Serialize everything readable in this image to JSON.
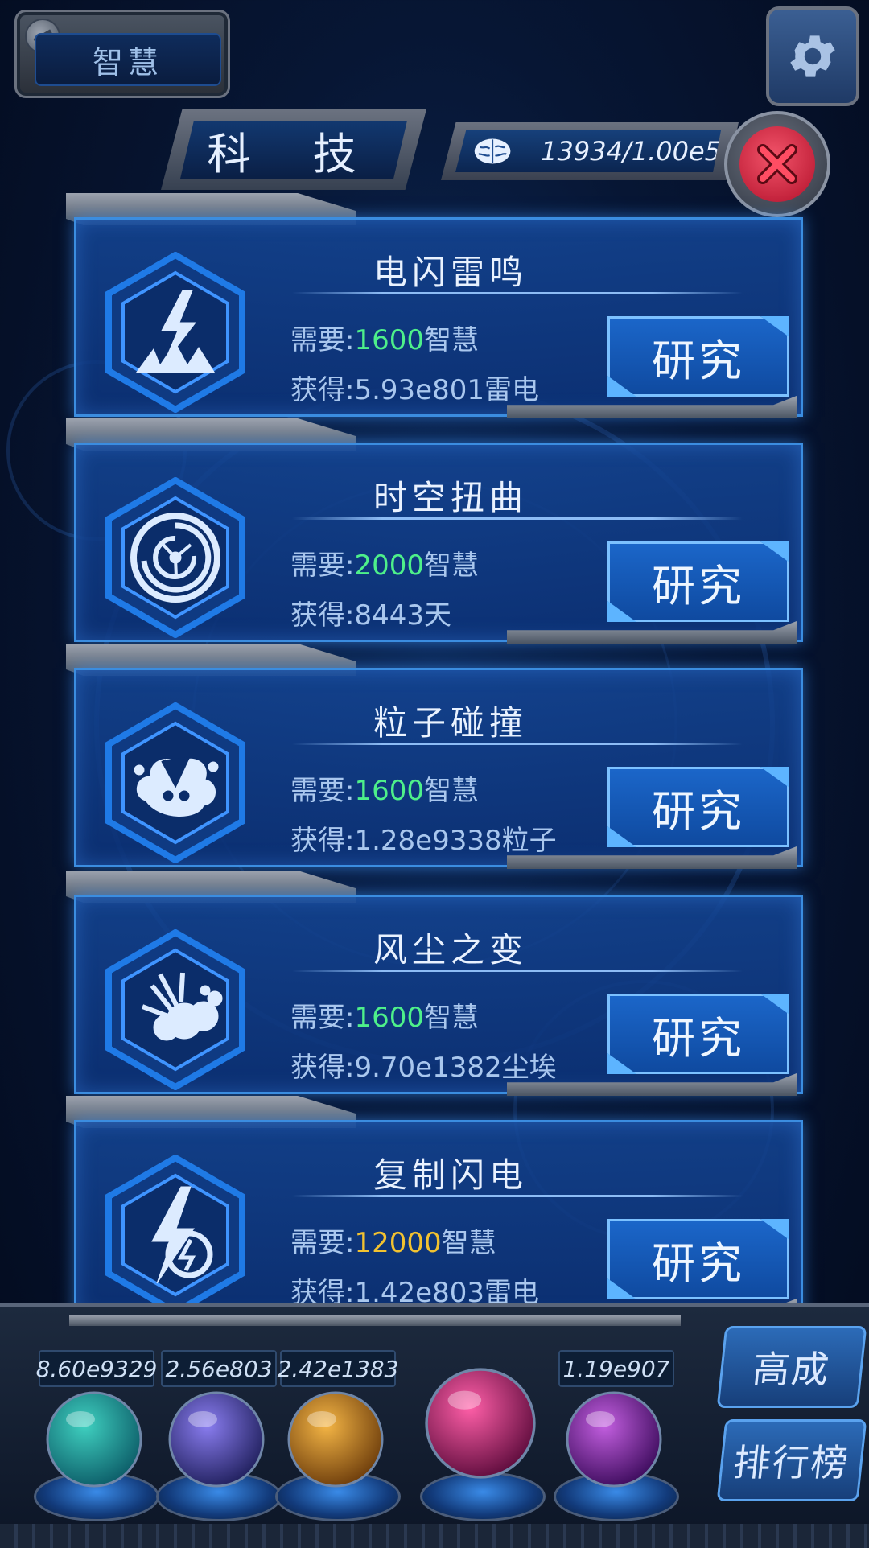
{
  "top": {
    "tab_label": "智慧"
  },
  "header": {
    "title": "科 技",
    "resource_value": "13934/1.00e5"
  },
  "labels": {
    "require": "需要:",
    "gain": "获得:",
    "cost_unit": "智慧"
  },
  "cards": [
    {
      "title": "电闪雷鸣",
      "cost": "1600",
      "cost_color": "#4ef08a",
      "gain": "5.93e801雷电",
      "button": "研究",
      "icon": "lightning-burst-icon"
    },
    {
      "title": "时空扭曲",
      "cost": "2000",
      "cost_color": "#4ef08a",
      "gain": "8443天",
      "button": "研究",
      "icon": "vortex-icon"
    },
    {
      "title": "粒子碰撞",
      "cost": "1600",
      "cost_color": "#4ef08a",
      "gain": "1.28e9338粒子",
      "button": "研究",
      "icon": "particle-collision-icon"
    },
    {
      "title": "风尘之变",
      "cost": "1600",
      "cost_color": "#4ef08a",
      "gain": "9.70e1382尘埃",
      "button": "研究",
      "icon": "dust-explosion-icon"
    },
    {
      "title": "复制闪电",
      "cost": "12000",
      "cost_color": "#f2c230",
      "gain": "1.42e803雷电",
      "button": "研究",
      "icon": "lightning-copy-icon"
    }
  ],
  "dock": {
    "counters": [
      "8.60e9329",
      "2.56e803",
      "2.42e1383",
      "",
      "1.19e907"
    ],
    "orbs": [
      "green-molecule-orb-icon",
      "lightning-orb-icon",
      "golden-dust-orb-icon",
      "brain-network-orb-icon",
      "purple-vortex-orb-icon"
    ],
    "side_buttons": [
      "高成",
      "排行榜"
    ]
  },
  "colors": {
    "accent": "#3b8de0",
    "cost_green": "#4ef08a",
    "cost_yellow": "#f2c230",
    "close_red": "#d11a36"
  }
}
